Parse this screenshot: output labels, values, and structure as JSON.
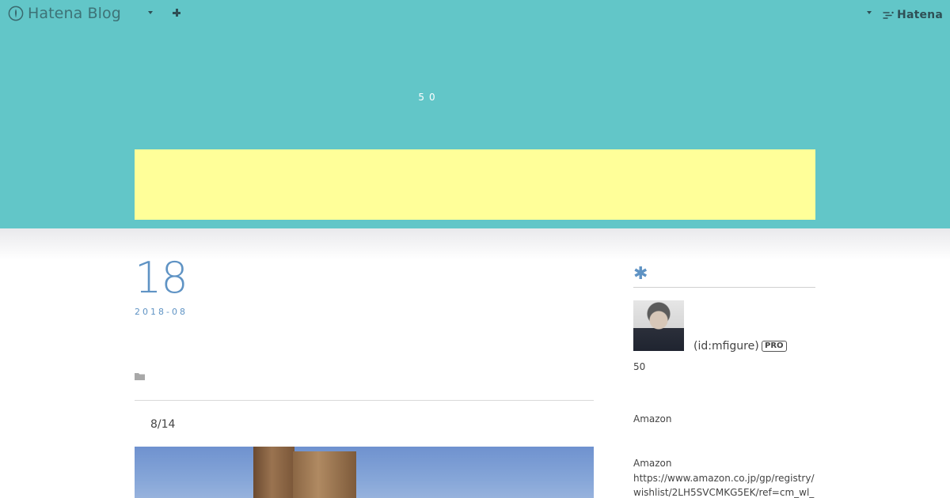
{
  "globalbar": {
    "brand": "Hatena Blog",
    "hatena": "Hatena",
    "icons": [
      "hatena-blog-logo-icon",
      "chevron-down-icon",
      "plus-icon",
      "chevron-down-icon",
      "hatena-logo-icon"
    ]
  },
  "header": {
    "description": "50"
  },
  "colors": {
    "header_bg": "#62c6c8",
    "banner_bg": "#ffff99",
    "accent": "#5f93c4"
  },
  "entry": {
    "day": "18",
    "year_month": "2018-08",
    "category_icon": "folder-icon",
    "date_text": "8/14"
  },
  "sidebar": {
    "title_icon": "asterisk-icon",
    "title_mark": "✱",
    "user_id": "(id:mfigure)",
    "pro_label": "PRO",
    "profile_text": "50",
    "module1_text": "Amazon",
    "module2_title": "Amazon",
    "module2_link": "https://www.amazon.co.jp/gp/registry/wishlist/2LH5SVCMKG5EK/ref=cm_wl_"
  }
}
